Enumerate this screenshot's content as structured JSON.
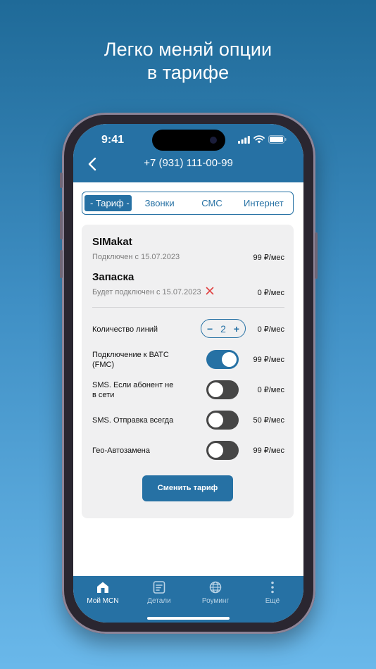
{
  "headline": {
    "line1": "Легко меняй опции",
    "line2": "в тарифе"
  },
  "status_bar": {
    "time": "9:41"
  },
  "header": {
    "phone_number": "+7 (931) 111-00-99"
  },
  "tabs": [
    {
      "label": "- Тариф -",
      "active": true
    },
    {
      "label": "Звонки",
      "active": false
    },
    {
      "label": "СМС",
      "active": false
    },
    {
      "label": "Интернет",
      "active": false
    }
  ],
  "plans": [
    {
      "name": "SIMakat",
      "status": "Подключен с 15.07.2023",
      "price": "99 ₽/мес"
    },
    {
      "name": "Запаска",
      "status": "Будет подключен с 15.07.2023",
      "price": "0 ₽/мес"
    }
  ],
  "options": {
    "lines": {
      "label": "Количество линий",
      "count": "2",
      "minus": "−",
      "plus": "+",
      "price": "0 ₽/мес"
    },
    "vats": {
      "label": "Подключение к ВАТС (FMC)",
      "on": true,
      "price": "99 ₽/мес"
    },
    "sms_online": {
      "label": "SMS. Если абонент не в сети",
      "on": false,
      "price": "0 ₽/мес"
    },
    "sms_always": {
      "label": "SMS. Отправка всегда",
      "on": false,
      "price": "50 ₽/мес"
    },
    "geo": {
      "label": "Гео-Автозамена",
      "on": false,
      "price": "99 ₽/мес"
    }
  },
  "change_button": "Сменить тариф",
  "bottom_nav": [
    {
      "label": "Мой MCN",
      "icon": "home-icon",
      "active": true
    },
    {
      "label": "Детали",
      "icon": "details-icon",
      "active": false
    },
    {
      "label": "Роуминг",
      "icon": "globe-icon",
      "active": false
    },
    {
      "label": "Ещё",
      "icon": "more-icon",
      "active": false
    }
  ],
  "colors": {
    "accent": "#2671a4",
    "toggle_off": "#464646",
    "cancel": "#e04040"
  }
}
